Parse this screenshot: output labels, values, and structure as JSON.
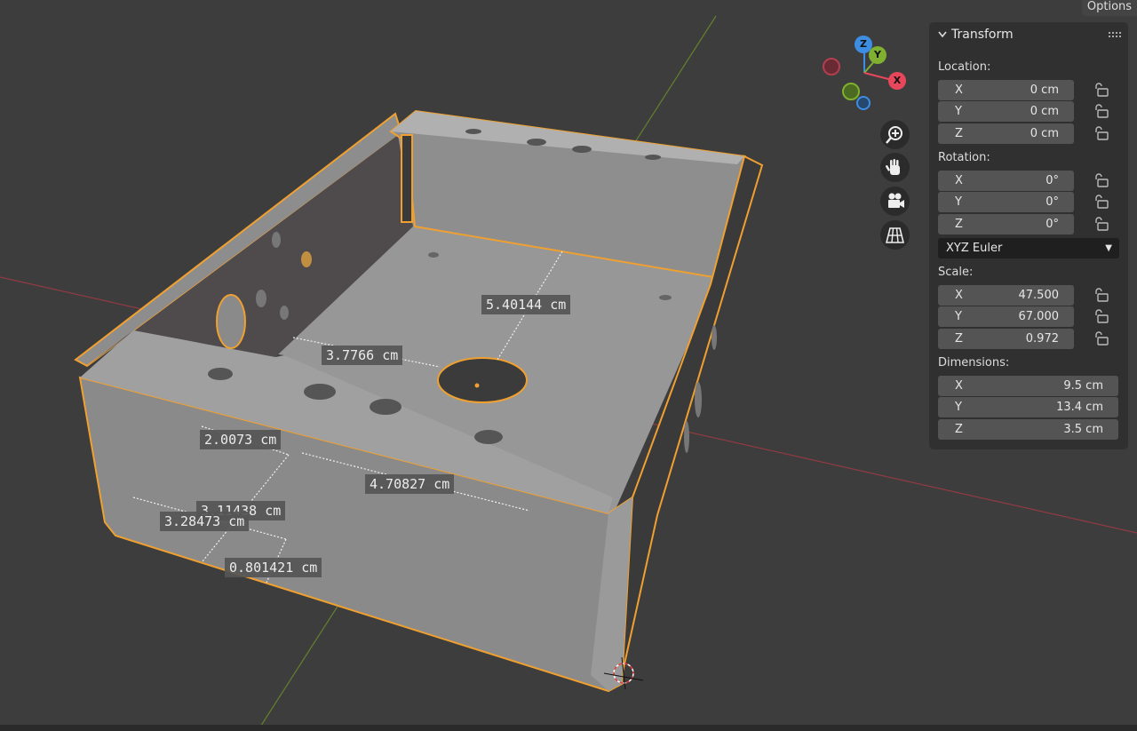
{
  "header": {
    "options_label": "Options"
  },
  "gizmo": {
    "z": "Z",
    "y": "Y",
    "x": "X"
  },
  "measurements": [
    {
      "text": "5.40144 cm"
    },
    {
      "text": "3.7766 cm"
    },
    {
      "text": "2.0073 cm"
    },
    {
      "text": "4.70827 cm"
    },
    {
      "text": "3.11438 cm"
    },
    {
      "text": "3.28473 cm"
    },
    {
      "text": "0.801421 cm"
    }
  ],
  "panel": {
    "title": "Transform",
    "location": {
      "label": "Location:",
      "x": "0 cm",
      "y": "0 cm",
      "z": "0 cm"
    },
    "rotation": {
      "label": "Rotation:",
      "x": "0°",
      "y": "0°",
      "z": "0°",
      "mode": "XYZ Euler"
    },
    "scale": {
      "label": "Scale:",
      "x": "47.500",
      "y": "67.000",
      "z": "0.972"
    },
    "dimensions": {
      "label": "Dimensions:",
      "x": "9.5 cm",
      "y": "13.4 cm",
      "z": "3.5 cm"
    },
    "axis_labels": {
      "x": "X",
      "y": "Y",
      "z": "Z"
    }
  },
  "colors": {
    "background": "#3d3d3d",
    "selection_outline": "#f0a030",
    "model_top": "#9a9a9a",
    "model_side": "#8a8a8a",
    "axis_x": "#e8475b",
    "axis_y": "#7fb02f",
    "axis_z": "#3d8ee2"
  },
  "icons": [
    "zoom-icon",
    "hand-pan-icon",
    "camera-icon",
    "grid-perspective-icon",
    "lock-icon",
    "chevron-down-icon"
  ]
}
